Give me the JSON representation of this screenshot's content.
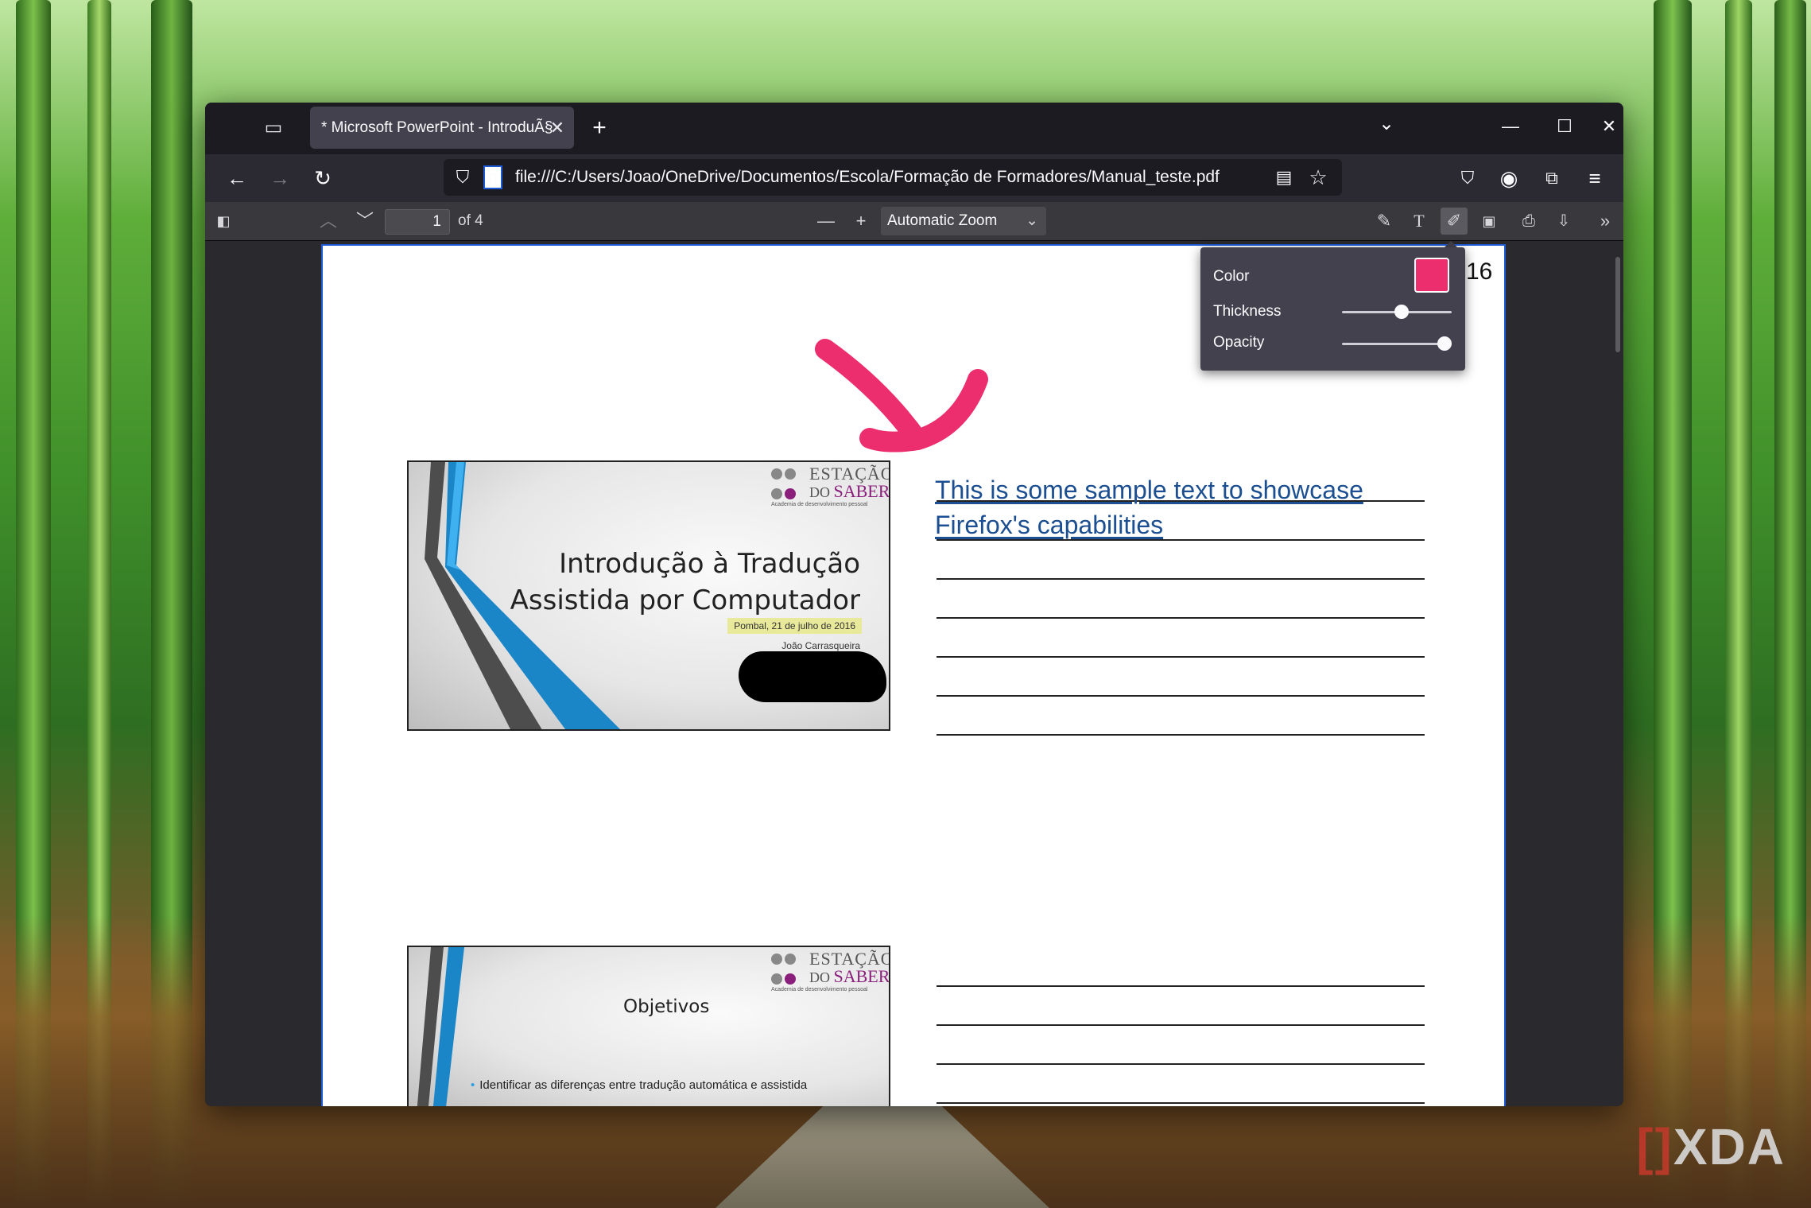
{
  "browser": {
    "tab_title": "* Microsoft PowerPoint - IntroduÃ§",
    "tab_close": "✕",
    "new_tab": "+",
    "url": "file:///C:/Users/Joao/OneDrive/Documentos/Escola/Formação de Formadores/Manual_teste.pdf"
  },
  "pdf_toolbar": {
    "page_number": "1",
    "page_of": "of 4",
    "zoom": "Automatic Zoom"
  },
  "pdf_page": {
    "page_label": "16",
    "sample_text_line1": "This is some sample text to showcase",
    "sample_text_line2": "Firefox's capabilities"
  },
  "slide1": {
    "brand_line1": "ESTAÇÃO",
    "brand_line2_prefix": "DO ",
    "brand_line2": "SABER",
    "brand_tagline": "Academia de desenvolvimento pessoal",
    "title_line1": "Introdução à Tradução",
    "title_line2": "Assistida por Computador",
    "date": "Pombal, 21 de julho de 2016",
    "author": "João Carrasqueira"
  },
  "slide2": {
    "brand_line1": "ESTAÇÃO",
    "brand_line2_prefix": "DO ",
    "brand_line2": "SABER",
    "brand_tagline": "Academia de desenvolvimento pessoal",
    "title": "Objetivos",
    "bullet1": "Identificar as diferenças entre tradução automática e assistida"
  },
  "draw_popup": {
    "color_label": "Color",
    "color_value": "#ec2d6e",
    "thickness_label": "Thickness",
    "thickness_value": 0.55,
    "opacity_label": "Opacity",
    "opacity_value": 1.0
  },
  "watermark": {
    "brand": "XDA"
  },
  "colors": {
    "ink": "#ec2d6e",
    "sample_text": "#1c4f91",
    "page_border": "#1d5bd6"
  }
}
